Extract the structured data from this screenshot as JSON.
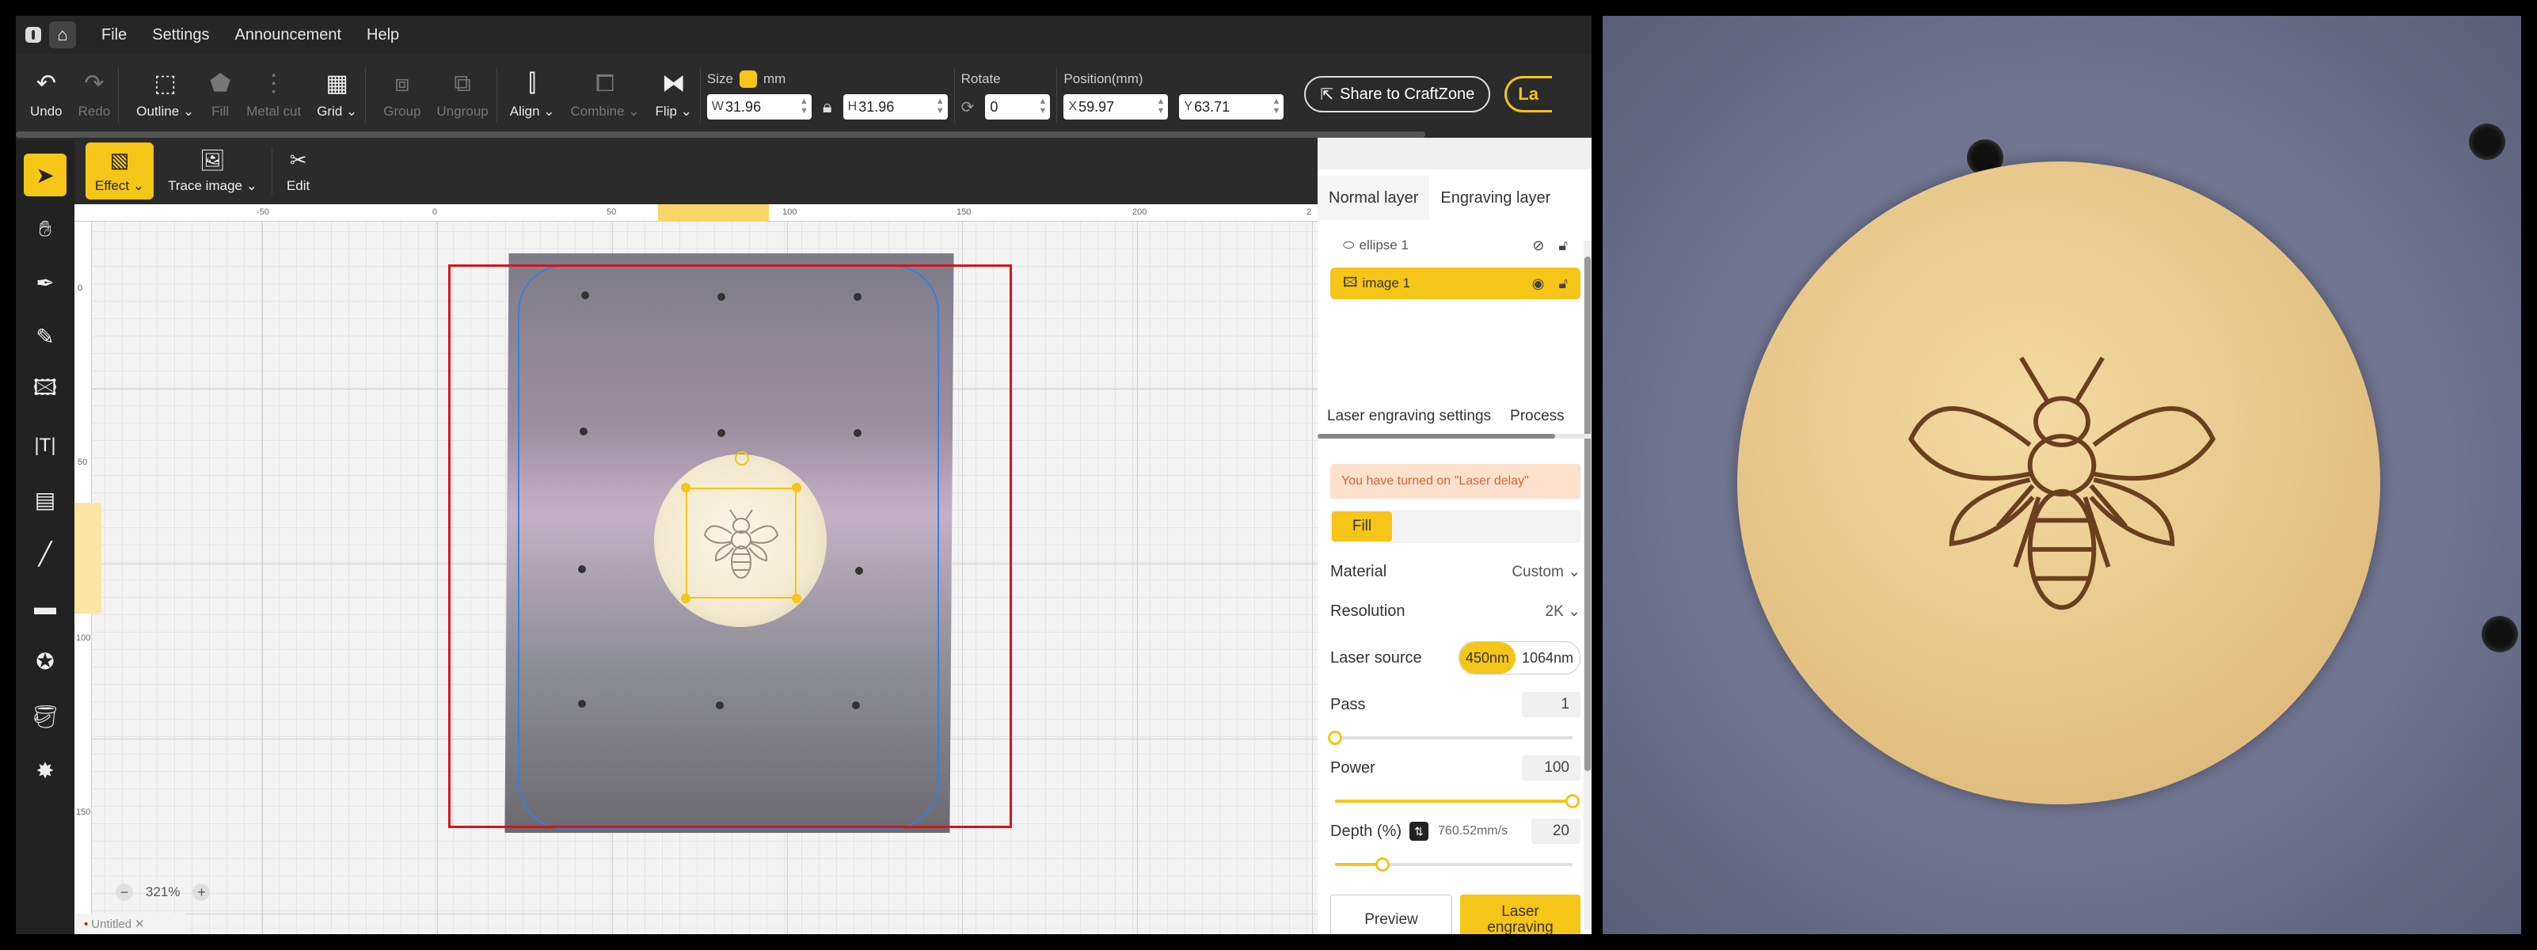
{
  "menu": {
    "items": [
      "File",
      "Settings",
      "Announcement",
      "Help"
    ]
  },
  "toolbar": {
    "undo": "Undo",
    "redo": "Redo",
    "outline": "Outline",
    "fill": "Fill",
    "metal_cut": "Metal cut",
    "grid": "Grid",
    "group": "Group",
    "ungroup": "Ungroup",
    "align": "Align",
    "combine": "Combine",
    "flip": "Flip",
    "size_label": "Size",
    "size_unit": "mm",
    "width_prefix": "W",
    "width": "31.96",
    "height_prefix": "H",
    "height": "31.96",
    "rotate_label": "Rotate",
    "rotate": "0",
    "position_label": "Position(mm)",
    "x_prefix": "X",
    "x": "59.97",
    "y_prefix": "Y",
    "y": "63.71",
    "share": "Share to CraftZone",
    "laser_cut": "La"
  },
  "subbar": {
    "effect": "Effect",
    "trace_image": "Trace image",
    "edit": "Edit"
  },
  "rulers": {
    "top": [
      "-50",
      "0",
      "50",
      "100",
      "150",
      "200",
      "2"
    ],
    "left": [
      "0",
      "50",
      "100",
      "150"
    ]
  },
  "canvas": {
    "zoom": "321%",
    "file_tab": "Untitled"
  },
  "layers": {
    "tab_normal": "Normal layer",
    "tab_engraving": "Engraving layer",
    "items": [
      {
        "name": "ellipse 1"
      },
      {
        "name": "image 1"
      }
    ]
  },
  "settings": {
    "tab_laser": "Laser engraving settings",
    "tab_process": "Process",
    "notice": "You have turned on \"Laser delay\"",
    "fill_button": "Fill",
    "material_label": "Material",
    "material": "Custom",
    "resolution_label": "Resolution",
    "resolution": "2K",
    "laser_source_label": "Laser source",
    "source_450": "450nm",
    "source_1064": "1064nm",
    "pass_label": "Pass",
    "pass": "1",
    "power_label": "Power",
    "power": "100",
    "depth_label": "Depth (%)",
    "speed": "760.52mm/s",
    "depth": "20",
    "preview": "Preview",
    "laser_engraving_1": "Laser",
    "laser_engraving_2": "engraving"
  },
  "sliders": {
    "pass_fraction": 0.0,
    "power_fraction": 1.0,
    "depth_fraction": 0.2
  },
  "colors": {
    "accent": "#f5c518",
    "selection_red": "#d9141a",
    "workarea_blue": "#3b7fd4",
    "notice_text": "#c86a36"
  }
}
